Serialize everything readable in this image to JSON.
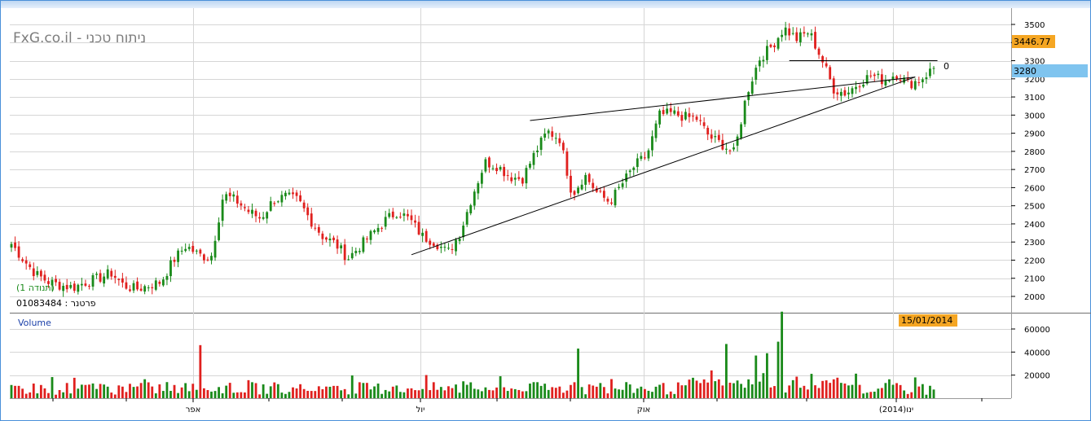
{
  "watermark": "FxG.co.il - ניתוח טכני",
  "indicator_label": "(תנודה 1)",
  "partner_label": "פרטנר : 01083484",
  "volume_label": "Volume",
  "date_box": "15/01/2014",
  "last_price_box": "3446.77",
  "level_box": "3280",
  "pattern_label": "0",
  "colors": {
    "up": "#1a8a1a",
    "down": "#e0201e",
    "frame": "#4a90d9",
    "price_box": "#f5a623",
    "level_box": "#7fc4ef"
  },
  "chart_data": [
    {
      "type": "candlestick",
      "title": "",
      "y_ticks": [
        2000,
        2100,
        2200,
        2300,
        2400,
        2500,
        2600,
        2700,
        2800,
        2900,
        3000,
        3100,
        3200,
        3300,
        3400,
        3500
      ],
      "ylim": [
        1900,
        3560
      ],
      "x_ticks": [
        "אפר",
        "יול",
        "אוק",
        "ינו(2014)"
      ],
      "grid": true,
      "anchors": [
        2290,
        2200,
        2120,
        2080,
        2060,
        2050,
        2080,
        2100,
        2130,
        2060,
        2040,
        2060,
        2080,
        2200,
        2280,
        2230,
        2210,
        2560,
        2530,
        2470,
        2430,
        2530,
        2550,
        2530,
        2420,
        2330,
        2290,
        2210,
        2280,
        2350,
        2420,
        2470,
        2420,
        2330,
        2300,
        2240,
        2350,
        2560,
        2740,
        2720,
        2660,
        2650,
        2790,
        2910,
        2870,
        2560,
        2670,
        2570,
        2520,
        2620,
        2720,
        2780,
        3000,
        3010,
        2990,
        2980,
        2880,
        2840,
        2790,
        3120,
        3310,
        3380,
        3480,
        3420,
        3460,
        3310,
        3140,
        3120,
        3180,
        3220,
        3190,
        3230,
        3170,
        3200,
        3260
      ],
      "candle_count": 250,
      "last_price": 3446.77,
      "level": 3280,
      "trendlines": [
        {
          "name": "lower-support",
          "from": {
            "index": 108,
            "value": 2230
          },
          "to": {
            "index": 244,
            "value": 3210
          }
        },
        {
          "name": "upper-resistance",
          "from": {
            "index": 140,
            "value": 2970
          },
          "to": {
            "index": 244,
            "value": 3210
          }
        },
        {
          "name": "horizontal-resistance",
          "from": {
            "index": 210,
            "value": 3300
          },
          "to": {
            "index": 250,
            "value": 3300
          }
        }
      ]
    },
    {
      "type": "bar",
      "title": "",
      "series": [
        {
          "values_shape": "volume"
        }
      ],
      "y_ticks": [
        20000,
        40000,
        60000
      ],
      "ylim": [
        0,
        75000
      ],
      "spikes": [
        {
          "index": 51,
          "value": 46000
        },
        {
          "index": 153,
          "value": 43000
        },
        {
          "index": 193,
          "value": 47000
        },
        {
          "index": 208,
          "value": 75000
        },
        {
          "index": 207,
          "value": 49000
        },
        {
          "index": 204,
          "value": 39000
        },
        {
          "index": 201,
          "value": 37000
        }
      ]
    }
  ]
}
